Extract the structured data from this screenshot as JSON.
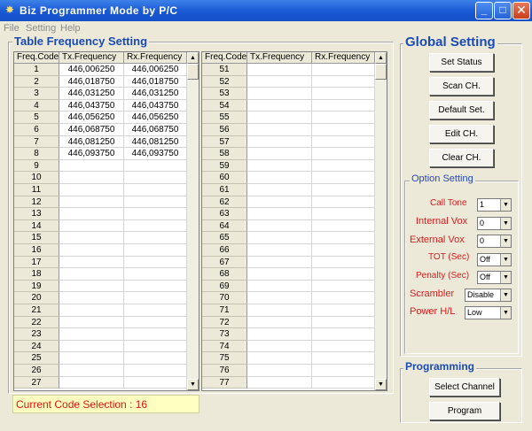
{
  "window": {
    "title": "Biz Programmer Mode by  P/C",
    "minimize_glyph": "_",
    "maximize_glyph": "□",
    "close_glyph": "✕"
  },
  "menu": {
    "file": "File",
    "setting": "Setting",
    "help": "Help"
  },
  "table_frequency": {
    "legend": "Table Frequency Setting",
    "columns": [
      "Freq.Code",
      "Tx.Frequency",
      "Rx.Frequency"
    ],
    "scroll_up": "▲",
    "scroll_down": "▼",
    "left_rows": [
      {
        "code": "1",
        "tx": "446,006250",
        "rx": "446,006250"
      },
      {
        "code": "2",
        "tx": "446,018750",
        "rx": "446,018750"
      },
      {
        "code": "3",
        "tx": "446,031250",
        "rx": "446,031250"
      },
      {
        "code": "4",
        "tx": "446,043750",
        "rx": "446,043750"
      },
      {
        "code": "5",
        "tx": "446,056250",
        "rx": "446,056250"
      },
      {
        "code": "6",
        "tx": "446,068750",
        "rx": "446,068750"
      },
      {
        "code": "7",
        "tx": "446,081250",
        "rx": "446,081250"
      },
      {
        "code": "8",
        "tx": "446,093750",
        "rx": "446,093750"
      },
      {
        "code": "9",
        "tx": "",
        "rx": ""
      },
      {
        "code": "10",
        "tx": "",
        "rx": ""
      },
      {
        "code": "11",
        "tx": "",
        "rx": ""
      },
      {
        "code": "12",
        "tx": "",
        "rx": ""
      },
      {
        "code": "13",
        "tx": "",
        "rx": ""
      },
      {
        "code": "14",
        "tx": "",
        "rx": ""
      },
      {
        "code": "15",
        "tx": "",
        "rx": ""
      },
      {
        "code": "16",
        "tx": "",
        "rx": ""
      },
      {
        "code": "17",
        "tx": "",
        "rx": ""
      },
      {
        "code": "18",
        "tx": "",
        "rx": ""
      },
      {
        "code": "19",
        "tx": "",
        "rx": ""
      },
      {
        "code": "20",
        "tx": "",
        "rx": ""
      },
      {
        "code": "21",
        "tx": "",
        "rx": ""
      },
      {
        "code": "22",
        "tx": "",
        "rx": ""
      },
      {
        "code": "23",
        "tx": "",
        "rx": ""
      },
      {
        "code": "24",
        "tx": "",
        "rx": ""
      },
      {
        "code": "25",
        "tx": "",
        "rx": ""
      },
      {
        "code": "26",
        "tx": "",
        "rx": ""
      },
      {
        "code": "27",
        "tx": "",
        "rx": ""
      }
    ],
    "right_rows": [
      {
        "code": "51",
        "tx": "",
        "rx": ""
      },
      {
        "code": "52",
        "tx": "",
        "rx": ""
      },
      {
        "code": "53",
        "tx": "",
        "rx": ""
      },
      {
        "code": "54",
        "tx": "",
        "rx": ""
      },
      {
        "code": "55",
        "tx": "",
        "rx": ""
      },
      {
        "code": "56",
        "tx": "",
        "rx": ""
      },
      {
        "code": "57",
        "tx": "",
        "rx": ""
      },
      {
        "code": "58",
        "tx": "",
        "rx": ""
      },
      {
        "code": "59",
        "tx": "",
        "rx": ""
      },
      {
        "code": "60",
        "tx": "",
        "rx": ""
      },
      {
        "code": "61",
        "tx": "",
        "rx": ""
      },
      {
        "code": "62",
        "tx": "",
        "rx": ""
      },
      {
        "code": "63",
        "tx": "",
        "rx": ""
      },
      {
        "code": "64",
        "tx": "",
        "rx": ""
      },
      {
        "code": "65",
        "tx": "",
        "rx": ""
      },
      {
        "code": "66",
        "tx": "",
        "rx": ""
      },
      {
        "code": "67",
        "tx": "",
        "rx": ""
      },
      {
        "code": "68",
        "tx": "",
        "rx": ""
      },
      {
        "code": "69",
        "tx": "",
        "rx": ""
      },
      {
        "code": "70",
        "tx": "",
        "rx": ""
      },
      {
        "code": "71",
        "tx": "",
        "rx": ""
      },
      {
        "code": "72",
        "tx": "",
        "rx": ""
      },
      {
        "code": "73",
        "tx": "",
        "rx": ""
      },
      {
        "code": "74",
        "tx": "",
        "rx": ""
      },
      {
        "code": "75",
        "tx": "",
        "rx": ""
      },
      {
        "code": "76",
        "tx": "",
        "rx": ""
      },
      {
        "code": "77",
        "tx": "",
        "rx": ""
      }
    ]
  },
  "status": {
    "current_code": "Current Code Selection : 16"
  },
  "global_setting": {
    "legend": "Global Setting",
    "set_status": "Set Status",
    "scan_ch": "Scan CH.",
    "default_set": "Default Set.",
    "edit_ch": "Edit CH.",
    "clear_ch": "Clear CH."
  },
  "option_setting": {
    "legend": "Option Setting",
    "dropdown_glyph": "▼",
    "call_tone_label": "Call Tone",
    "call_tone_value": "1",
    "internal_vox_label": "Internal  Vox",
    "internal_vox_value": "0",
    "external_vox_label": "External  Vox",
    "external_vox_value": "0",
    "tot_label": "TOT (Sec)",
    "tot_value": "Off",
    "penalty_label": "Penalty (Sec)",
    "penalty_value": "Off",
    "scrambler_label": "Scrambler",
    "scrambler_value": "Disable",
    "power_label": "Power H/L",
    "power_value": "Low"
  },
  "programming": {
    "legend": "Programming",
    "select_channel": "Select Channel",
    "program": "Program"
  },
  "colors": {
    "window_bg": "#ece9d8",
    "title_blue": "#1b5ad6",
    "legend_blue": "#1a4ab4",
    "option_red": "#d81d1d",
    "status_bg": "#ffffc0",
    "status_text": "#e1120f"
  }
}
